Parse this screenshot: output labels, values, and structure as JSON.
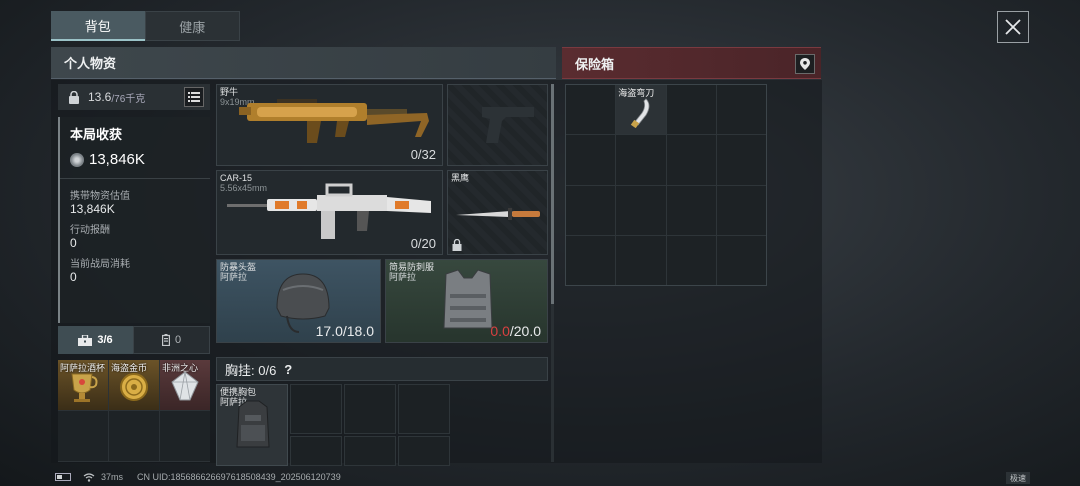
{
  "tabs": [
    {
      "label": "背包",
      "active": true
    },
    {
      "label": "健康",
      "active": false
    }
  ],
  "personal": {
    "title": "个人物资",
    "weight_current": "13.6",
    "weight_max": "/76千克",
    "stats": {
      "title": "本局收获",
      "total": "13,846K",
      "carried_label": "携带物资估值",
      "carried_value": "13,846K",
      "reward_label": "行动报酬",
      "reward_value": "0",
      "cost_label": "当前战局消耗",
      "cost_value": "0"
    },
    "category_tabs": [
      {
        "icon": "toolbox-icon",
        "label": "3/6",
        "active": true
      },
      {
        "icon": "battery-icon",
        "label": "0",
        "active": false
      }
    ],
    "small_items": [
      "阿萨拉酒杯",
      "海盗金币",
      "非洲之心"
    ]
  },
  "weapons": {
    "primary": {
      "name": "野牛",
      "caliber": "9x19mm",
      "ammo": "0/32"
    },
    "secondary": {
      "name": "",
      "caliber": "",
      "ammo": ""
    },
    "rifle": {
      "name": "CAR-15",
      "caliber": "5.56x45mm",
      "ammo": "0/20"
    },
    "melee": {
      "name": "黑鹰"
    }
  },
  "gear": {
    "helmet": {
      "name": "防暴头盔",
      "origin": "阿萨拉",
      "durability": "17.0/18.0"
    },
    "armor": {
      "name": "简易防刺服",
      "origin": "阿萨拉",
      "durability_current": "0.0",
      "durability_max": "/20.0"
    }
  },
  "chest_rig": {
    "title": "胸挂: 0/6",
    "help": "?",
    "bag_name": "便携胸包",
    "bag_origin": "阿萨拉"
  },
  "safebox": {
    "title": "保险箱",
    "item": "海盗弯刀"
  },
  "status": {
    "ping": "37ms",
    "uid": "CN UID:185686626697618508439_202506120739",
    "speed": "极速"
  },
  "colors": {
    "accent": "#9bc3c8",
    "safe_header": "#5a2c30",
    "durability_low": "#d84040"
  }
}
